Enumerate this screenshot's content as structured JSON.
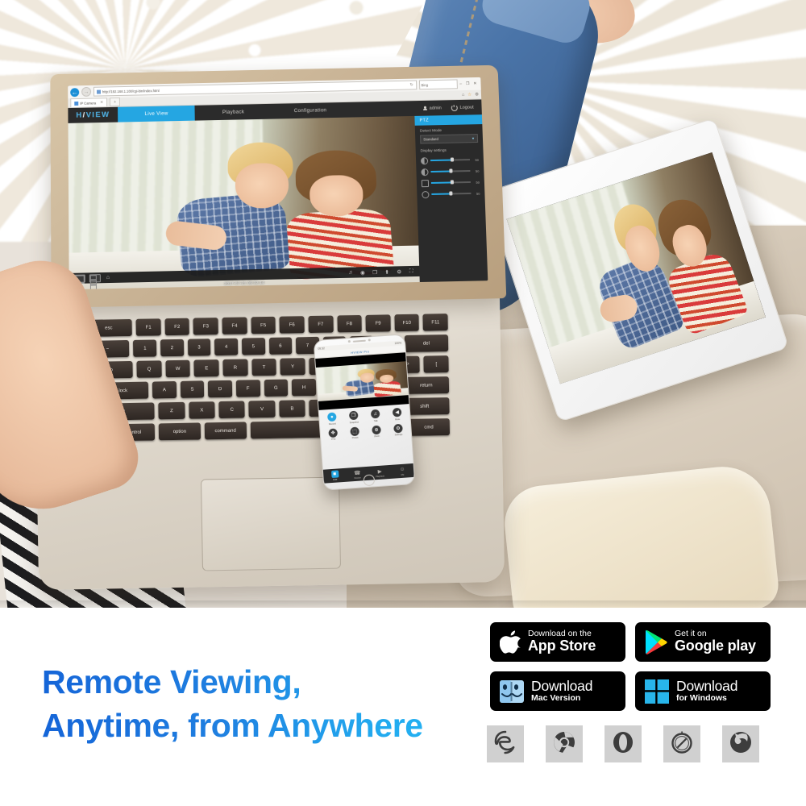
{
  "headline": {
    "line1": "Remote Viewing,",
    "line2": "Anytime, from Anywhere",
    "gradient_from": "#1565d8",
    "gradient_to": "#24b7f5"
  },
  "badges": [
    {
      "id": "app-store",
      "icon": "apple-icon",
      "small": "Download on the",
      "big": "App Store"
    },
    {
      "id": "google-play",
      "icon": "google-play-icon",
      "small": "Get it on",
      "big": "Google play"
    },
    {
      "id": "mac-version",
      "icon": "finder-icon",
      "big": "Download",
      "small": "Mac Version"
    },
    {
      "id": "windows",
      "icon": "windows-icon",
      "big": "Download",
      "small": "for Windows"
    }
  ],
  "browsers": [
    {
      "id": "edge",
      "icon": "edge-icon",
      "glyph": "e"
    },
    {
      "id": "chrome",
      "icon": "chrome-icon",
      "glyph": ""
    },
    {
      "id": "opera",
      "icon": "opera-icon",
      "glyph": "O"
    },
    {
      "id": "safari",
      "icon": "safari-icon",
      "glyph": ""
    },
    {
      "id": "firefox",
      "icon": "firefox-icon",
      "glyph": ""
    }
  ],
  "browser_chrome": {
    "back_glyph": "←",
    "forward_glyph": "→",
    "url": "http://192.168.1.100/cgi-bin/index.html",
    "refresh_glyph": "↻",
    "search_placeholder": "Bing",
    "tab_title": "IP Camera",
    "new_tab_glyph": "+",
    "window_buttons": [
      "–",
      "❐",
      "✕"
    ],
    "tool_icons": [
      "⌂",
      "☆",
      "⚙"
    ]
  },
  "app": {
    "logo_pre": "H",
    "logo_slash": "/",
    "logo_post": "VIEW",
    "tabs": [
      {
        "label": "Live View",
        "active": true
      },
      {
        "label": "Playback",
        "active": false
      },
      {
        "label": "Configuration",
        "active": false
      }
    ],
    "user": "admin",
    "logout": "Logout",
    "panel": {
      "header": "PTZ",
      "detect_label": "Detect Mode",
      "detect_value": "Standard",
      "display_label": "Display settings",
      "sliders": [
        {
          "name": "brightness",
          "value": "50"
        },
        {
          "name": "contrast",
          "value": "50"
        },
        {
          "name": "saturation",
          "value": "50"
        },
        {
          "name": "sharpness",
          "value": "50"
        }
      ]
    },
    "video": {
      "timestamp": "2017-07-21 09:32:14",
      "layout_buttons": [
        "1",
        "4",
        "9"
      ],
      "capture_button": "⌂",
      "right_icons": [
        "♫",
        "◉",
        "❐",
        "⬆",
        "⚙",
        "⛶"
      ]
    }
  },
  "phone": {
    "status_left": "09:32",
    "status_right": "100%",
    "title": "HVIEW Pro",
    "buttons": [
      {
        "label": "Record",
        "glyph": "●",
        "active": true
      },
      {
        "label": "Snapshot",
        "glyph": "❐",
        "active": false
      },
      {
        "label": "Talk",
        "glyph": "♫",
        "active": false
      },
      {
        "label": "Mute",
        "glyph": "◀",
        "active": false
      },
      {
        "label": "PTZ",
        "glyph": "✥",
        "active": false
      },
      {
        "label": "Preset",
        "glyph": "⬚",
        "active": false
      },
      {
        "label": "Zoom",
        "glyph": "⊕",
        "active": false
      },
      {
        "label": "Settings",
        "glyph": "⚙",
        "active": false
      }
    ],
    "tabs": [
      {
        "label": "Live",
        "glyph": "■",
        "active": true
      },
      {
        "label": "Device",
        "glyph": "☎",
        "active": false
      },
      {
        "label": "Playback",
        "glyph": "▶",
        "active": false
      },
      {
        "label": "Me",
        "glyph": "☺",
        "active": false
      }
    ]
  }
}
